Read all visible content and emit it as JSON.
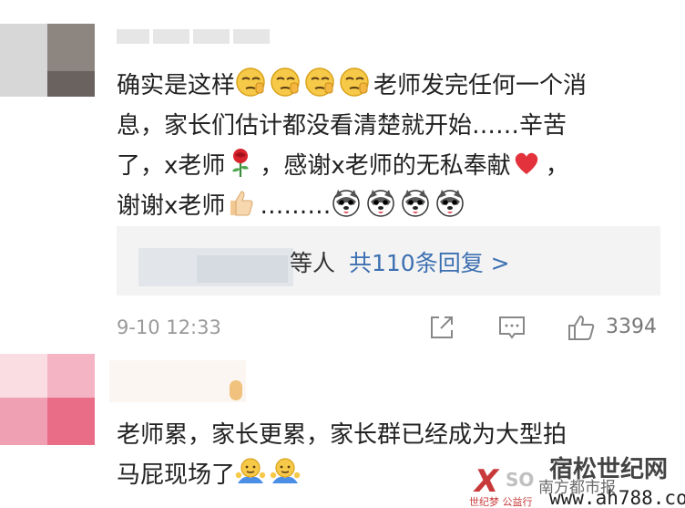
{
  "comments": [
    {
      "text_1": "确实是这样",
      "text_2": "老师发完任何一个消",
      "text_3": "息，家长们估计都没看清楚就开始……辛苦",
      "text_4a": "了，x老师",
      "text_4b": "，感谢x老师的无私奉献",
      "text_4c": "，",
      "text_5a": "谢谢x老师",
      "text_5b": "………",
      "replies_who": "等人",
      "replies_link": "共110条回复 >",
      "time": "9-10 12:33",
      "likes": "3394"
    },
    {
      "text_1": "老师累，家长更累，家长群已经成为大型拍",
      "text_2": "马屁现场了"
    }
  ],
  "watermark": {
    "x": "X",
    "so": "SO",
    "tagline": "世纪梦 公益行",
    "brand": "宿松世纪网",
    "sub": "南方都市报",
    "url": "www.ah788.com"
  },
  "icons": [
    "pensive-emoji",
    "rose-emoji",
    "heart-emoji",
    "thumbs-up-emoji",
    "husky-emoji",
    "shrug-emoji",
    "share-icon",
    "comment-icon",
    "like-icon"
  ]
}
